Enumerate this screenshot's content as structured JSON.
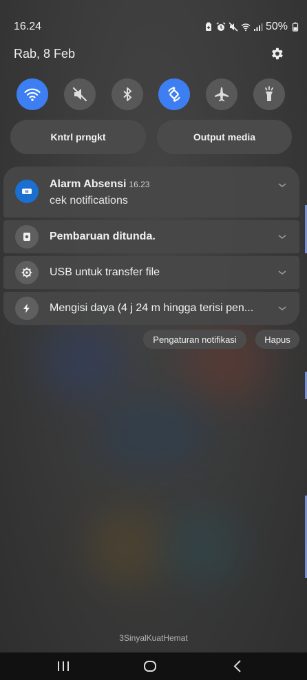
{
  "status_bar": {
    "time": "16.24",
    "battery": "50%",
    "icons": [
      "battery-saver-icon",
      "alarm-icon",
      "mute-icon",
      "wifi-icon",
      "signal-icon",
      "battery-icon"
    ]
  },
  "header": {
    "date": "Rab, 8 Feb",
    "settings_icon": "gear-icon"
  },
  "quick_settings": [
    {
      "name": "wifi",
      "icon": "wifi-icon",
      "active": true
    },
    {
      "name": "sound",
      "icon": "mute-icon",
      "active": false
    },
    {
      "name": "bluetooth",
      "icon": "bluetooth-icon",
      "active": false
    },
    {
      "name": "auto-rotate",
      "icon": "auto-rotate-icon",
      "active": true
    },
    {
      "name": "airplane",
      "icon": "airplane-icon",
      "active": false
    },
    {
      "name": "flashlight",
      "icon": "flashlight-icon",
      "active": false
    }
  ],
  "panels": {
    "device_control": "Kntrl prngkt",
    "media_output": "Output media"
  },
  "notifications": [
    {
      "app_icon": "meet-app-icon",
      "title": "Alarm Absensi",
      "time": "16.23",
      "text": "cek notifications"
    },
    {
      "app_icon": "update-icon",
      "title": "Pembaruan ditunda."
    },
    {
      "app_icon": "usb-icon",
      "title": "USB untuk transfer file"
    },
    {
      "app_icon": "charging-icon",
      "title": "Mengisi daya (4 j 24 m hingga terisi pen..."
    }
  ],
  "actions": {
    "settings": "Pengaturan notifikasi",
    "clear": "Hapus"
  },
  "carrier": "3SinyalKuatHemat",
  "colors": {
    "accent": "#3d7ff2",
    "background": "#3b3b3b",
    "card": "#484848"
  }
}
